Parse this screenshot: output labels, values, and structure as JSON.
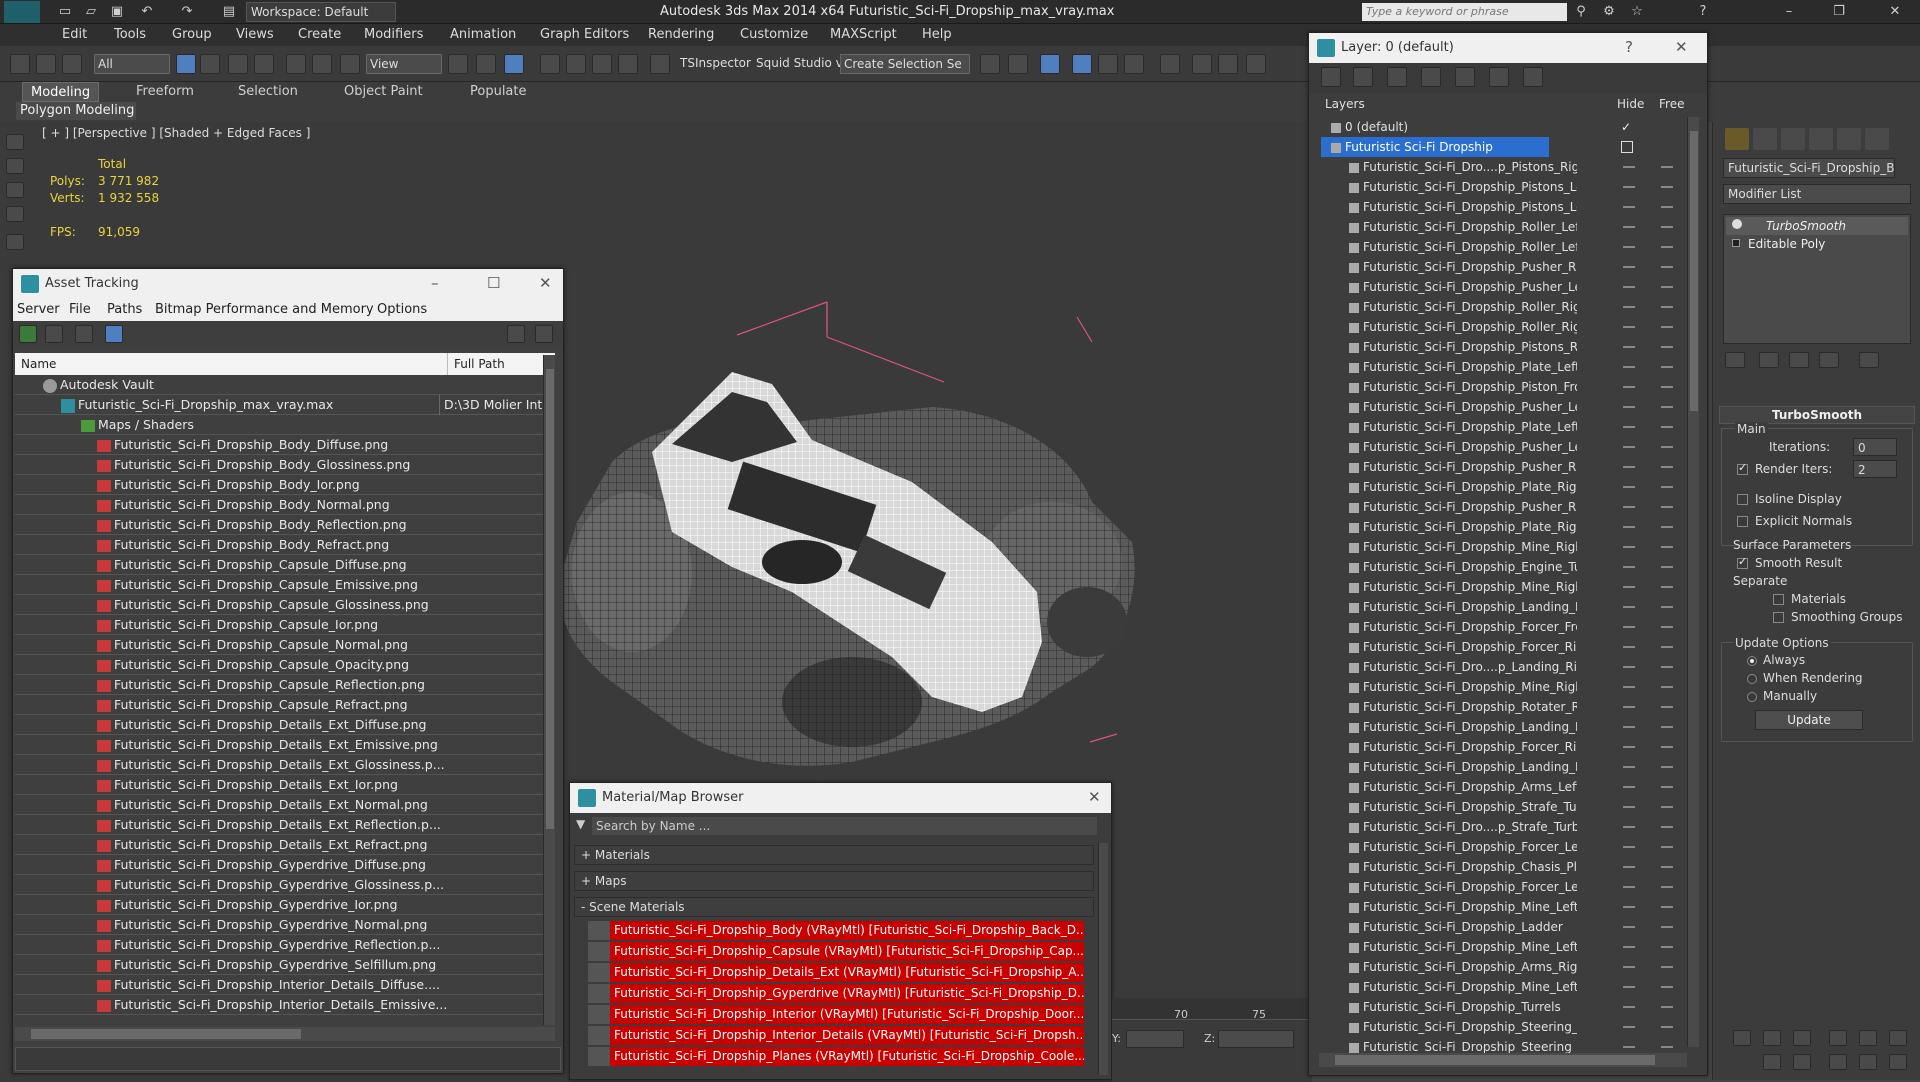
{
  "app": {
    "title": "Autodesk 3ds Max  2014 x64     Futuristic_Sci-Fi_Dropship_max_vray.max",
    "workspace": "Workspace: Default",
    "search_placeholder": "Type a keyword or phrase"
  },
  "menubar": [
    "Edit",
    "Tools",
    "Group",
    "Views",
    "Create",
    "Modifiers",
    "Animation",
    "Graph Editors",
    "Rendering",
    "Customize",
    "MAXScript",
    "Help"
  ],
  "toolbar": {
    "filter": "All",
    "coord": "View",
    "tsinspector": "TSInspector",
    "squid": "Squid Studio v",
    "selection_set": "Create Selection Se"
  },
  "ribbon": {
    "tabs": [
      "Modeling",
      "Freeform",
      "Selection",
      "Object Paint",
      "Populate"
    ],
    "active": "Modeling",
    "sub": "Polygon Modeling"
  },
  "viewport": {
    "label": "[ + ] [Perspective ] [Shaded + Edged Faces ]",
    "total": "Total",
    "polys_label": "Polys:",
    "polys": "3 771 982",
    "verts_label": "Verts:",
    "verts": "1 932 558",
    "fps_label": "FPS:",
    "fps": "91,059"
  },
  "asset_tracking": {
    "title": "Asset Tracking",
    "menu": [
      "Server",
      "File",
      "Paths",
      "Bitmap Performance and Memory",
      "Options"
    ],
    "col_name": "Name",
    "col_path": "Full Path",
    "vault": "Autodesk Vault",
    "max_file": "Futuristic_Sci-Fi_Dropship_max_vray.max",
    "max_path": "D:\\3D Molier Int",
    "maps": "Maps / Shaders",
    "files": [
      "Futuristic_Sci-Fi_Dropship_Body_Diffuse.png",
      "Futuristic_Sci-Fi_Dropship_Body_Glossiness.png",
      "Futuristic_Sci-Fi_Dropship_Body_Ior.png",
      "Futuristic_Sci-Fi_Dropship_Body_Normal.png",
      "Futuristic_Sci-Fi_Dropship_Body_Reflection.png",
      "Futuristic_Sci-Fi_Dropship_Body_Refract.png",
      "Futuristic_Sci-Fi_Dropship_Capsule_Diffuse.png",
      "Futuristic_Sci-Fi_Dropship_Capsule_Emissive.png",
      "Futuristic_Sci-Fi_Dropship_Capsule_Glossiness.png",
      "Futuristic_Sci-Fi_Dropship_Capsule_Ior.png",
      "Futuristic_Sci-Fi_Dropship_Capsule_Normal.png",
      "Futuristic_Sci-Fi_Dropship_Capsule_Opacity.png",
      "Futuristic_Sci-Fi_Dropship_Capsule_Reflection.png",
      "Futuristic_Sci-Fi_Dropship_Capsule_Refract.png",
      "Futuristic_Sci-Fi_Dropship_Details_Ext_Diffuse.png",
      "Futuristic_Sci-Fi_Dropship_Details_Ext_Emissive.png",
      "Futuristic_Sci-Fi_Dropship_Details_Ext_Glossiness.p...",
      "Futuristic_Sci-Fi_Dropship_Details_Ext_Ior.png",
      "Futuristic_Sci-Fi_Dropship_Details_Ext_Normal.png",
      "Futuristic_Sci-Fi_Dropship_Details_Ext_Reflection.p...",
      "Futuristic_Sci-Fi_Dropship_Details_Ext_Refract.png",
      "Futuristic_Sci-Fi_Dropship_Gyperdrive_Diffuse.png",
      "Futuristic_Sci-Fi_Dropship_Gyperdrive_Glossiness.p...",
      "Futuristic_Sci-Fi_Dropship_Gyperdrive_Ior.png",
      "Futuristic_Sci-Fi_Dropship_Gyperdrive_Normal.png",
      "Futuristic_Sci-Fi_Dropship_Gyperdrive_Reflection.p...",
      "Futuristic_Sci-Fi_Dropship_Gyperdrive_Selfillum.png",
      "Futuristic_Sci-Fi_Dropship_Interior_Details_Diffuse....",
      "Futuristic_Sci-Fi_Dropship_Interior_Details_Emissive..."
    ]
  },
  "material_browser": {
    "title": "Material/Map Browser",
    "search": "Search by Name ...",
    "sections": [
      "+ Materials",
      "+ Maps",
      "- Scene Materials"
    ],
    "items": [
      "Futuristic_Sci-Fi_Dropship_Body (VRayMtl) [Futuristic_Sci-Fi_Dropship_Back_D...",
      "Futuristic_Sci-Fi_Dropship_Capsule (VRayMtl) [Futuristic_Sci-Fi_Dropship_Cap...",
      "Futuristic_Sci-Fi_Dropship_Details_Ext (VRayMtl) [Futuristic_Sci-Fi_Dropship_A...",
      "Futuristic_Sci-Fi_Dropship_Gyperdrive (VRayMtl) [Futuristic_Sci-Fi_Dropship_D...",
      "Futuristic_Sci-Fi_Dropship_Interior (VRayMtl) [Futuristic_Sci-Fi_Dropship_Door...",
      "Futuristic_Sci-Fi_Dropship_Interior_Details (VRayMtl) [Futuristic_Sci-Fi_Dropsh...",
      "Futuristic_Sci-Fi_Dropship_Planes (VRayMtl) [Futuristic_Sci-Fi_Dropship_Coole..."
    ]
  },
  "layers": {
    "title": "Layer: 0 (default)",
    "col_layers": "Layers",
    "col_hide": "Hide",
    "col_free": "Free",
    "default_layer": "0 (default)",
    "selected_layer": "Futuristic Sci-Fi Dropship",
    "objects": [
      "Futuristic_Sci-Fi_Dro....p_Pistons_Righ",
      "Futuristic_Sci-Fi_Dropship_Pistons_Let",
      "Futuristic_Sci-Fi_Dropship_Pistons_Lef",
      "Futuristic_Sci-Fi_Dropship_Roller_Left",
      "Futuristic_Sci-Fi_Dropship_Roller_Left",
      "Futuristic_Sci-Fi_Dropship_Pusher_Rig",
      "Futuristic_Sci-Fi_Dropship_Pusher_Lef",
      "Futuristic_Sci-Fi_Dropship_Roller_Righ",
      "Futuristic_Sci-Fi_Dropship_Roller_Righ",
      "Futuristic_Sci-Fi_Dropship_Pistons_Rig",
      "Futuristic_Sci-Fi_Dropship_Plate_Left_",
      "Futuristic_Sci-Fi_Dropship_Piston_Fror",
      "Futuristic_Sci-Fi_Dropship_Pusher_Lef",
      "Futuristic_Sci-Fi_Dropship_Plate_Left_",
      "Futuristic_Sci-Fi_Dropship_Pusher_Lef",
      "Futuristic_Sci-Fi_Dropship_Pusher_Rig",
      "Futuristic_Sci-Fi_Dropship_Plate_Right",
      "Futuristic_Sci-Fi_Dropship_Pusher_Rig",
      "Futuristic_Sci-Fi_Dropship_Plate_Right",
      "Futuristic_Sci-Fi_Dropship_Mine_Right",
      "Futuristic_Sci-Fi_Dropship_Engine_Tur",
      "Futuristic_Sci-Fi_Dropship_Mine_Right",
      "Futuristic_Sci-Fi_Dropship_Landing_Ri",
      "Futuristic_Sci-Fi_Dropship_Forcer_Fro",
      "Futuristic_Sci-Fi_Dropship_Forcer_Rigl",
      "Futuristic_Sci-Fi_Dro....p_Landing_Righ",
      "Futuristic_Sci-Fi_Dropship_Mine_Right",
      "Futuristic_Sci-Fi_Dropship_Rotater_Ri",
      "Futuristic_Sci-Fi_Dropship_Landing_Le",
      "Futuristic_Sci-Fi_Dropship_Forcer_Rigl",
      "Futuristic_Sci-Fi_Dropship_Landing_Le",
      "Futuristic_Sci-Fi_Dropship_Arms_Left",
      "Futuristic_Sci-Fi_Dropship_Strafe_Turl",
      "Futuristic_Sci-Fi_Dro....p_Strafe_Turbi",
      "Futuristic_Sci-Fi_Dropship_Forcer_Lef",
      "Futuristic_Sci-Fi_Dropship_Chasis_Plat",
      "Futuristic_Sci-Fi_Dropship_Forcer_Lef",
      "Futuristic_Sci-Fi_Dropship_Mine_Left_",
      "Futuristic_Sci-Fi_Dropship_Ladder",
      "Futuristic_Sci-Fi_Dropship_Mine_Left_",
      "Futuristic_Sci-Fi_Dropship_Arms_Right",
      "Futuristic_Sci-Fi_Dropship_Mine_Left_",
      "Futuristic_Sci-Fi_Dropship_Turrels",
      "Futuristic_Sci-Fi_Dropship_Steering_R",
      "Futuristic_Sci-Fi_Dropship_Steering_Le"
    ]
  },
  "command_panel": {
    "object_name": "Futuristic_Sci-Fi_Dropship_Bo",
    "modifier_list": "Modifier List",
    "stack": [
      "TurboSmooth",
      "Editable Poly"
    ],
    "rollout": "TurboSmooth",
    "main": "Main",
    "iterations_label": "Iterations:",
    "iterations": "0",
    "render_iters_label": "Render Iters:",
    "render_iters": "2",
    "isoline": "Isoline Display",
    "explicit": "Explicit Normals",
    "surface_params": "Surface Parameters",
    "smooth_result": "Smooth Result",
    "separate": "Separate",
    "materials": "Materials",
    "smoothing_groups": "Smoothing Groups",
    "update_options": "Update Options",
    "always": "Always",
    "when_rendering": "When Rendering",
    "manually": "Manually",
    "update_btn": "Update"
  },
  "timeline": {
    "tick70": "70",
    "tick75": "75",
    "y_label": "Y:",
    "z_label": "Z:"
  }
}
